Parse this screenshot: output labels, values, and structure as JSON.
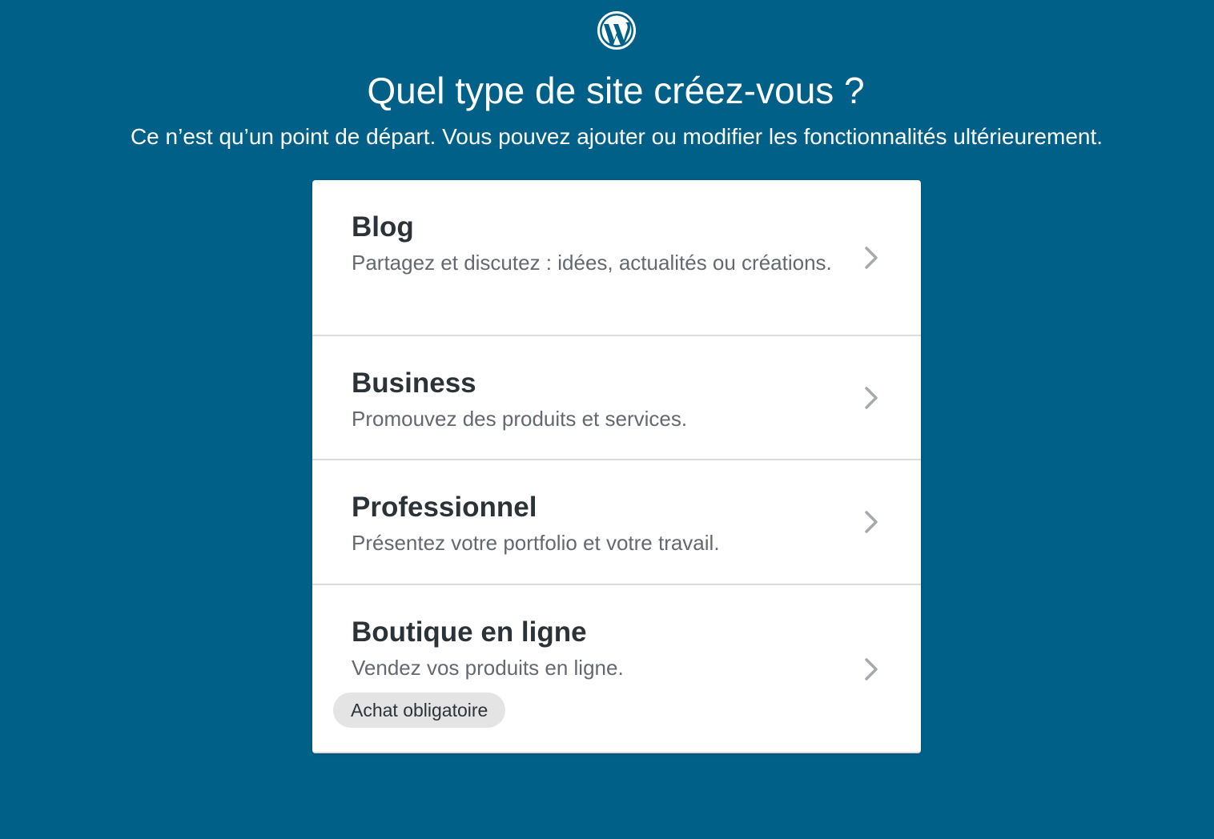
{
  "header": {
    "logo": "wordpress-logo",
    "title": "Quel type de site créez-vous ?",
    "subtitle": "Ce n’est qu’un point de départ. Vous pouvez ajouter ou modifier les fonctionnalités ultérieurement."
  },
  "options": [
    {
      "title": "Blog",
      "description": "Partagez et discutez : idées, actualités ou créations.",
      "icon": "chevron-right-icon"
    },
    {
      "title": "Business",
      "description": "Promouvez des produits et services.",
      "icon": "chevron-right-icon"
    },
    {
      "title": "Professionnel",
      "description": "Présentez votre portfolio et votre travail.",
      "icon": "chevron-right-icon"
    },
    {
      "title": "Boutique en ligne",
      "description": "Vendez vos produits en ligne.",
      "badge": "Achat obligatoire",
      "icon": "chevron-right-icon"
    }
  ],
  "colors": {
    "background": "#006088",
    "card": "#ffffff",
    "title_text": "#2c3338",
    "description_text": "#646970",
    "chevron": "#a7aaad",
    "badge_background": "#e4e4e4"
  }
}
